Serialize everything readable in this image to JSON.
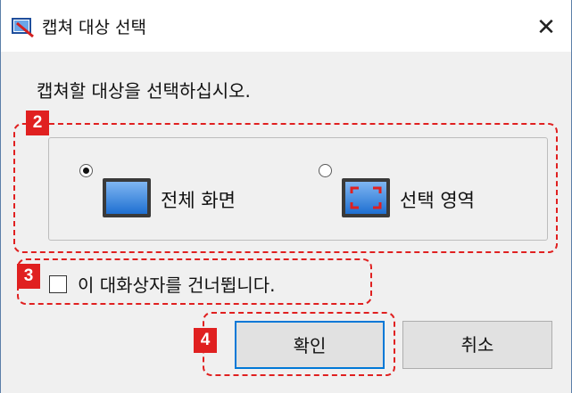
{
  "window": {
    "title": "캡쳐 대상 선택",
    "close_label": "✕"
  },
  "dialog": {
    "instruction": "캡쳐할 대상을 선택하십시오.",
    "options": [
      {
        "label": "전체 화면",
        "selected": true,
        "icon": "full-screen-icon"
      },
      {
        "label": "선택 영역",
        "selected": false,
        "icon": "selection-area-icon"
      }
    ],
    "skip_checkbox": {
      "label": "이 대화상자를 건너뜁니다.",
      "checked": false
    },
    "buttons": {
      "ok": "확인",
      "cancel": "취소"
    }
  },
  "callouts": [
    "2",
    "3",
    "4"
  ],
  "colors": {
    "callout": "#e02020",
    "focus": "#0078d7",
    "dialog_bg": "#f0f0f0"
  }
}
